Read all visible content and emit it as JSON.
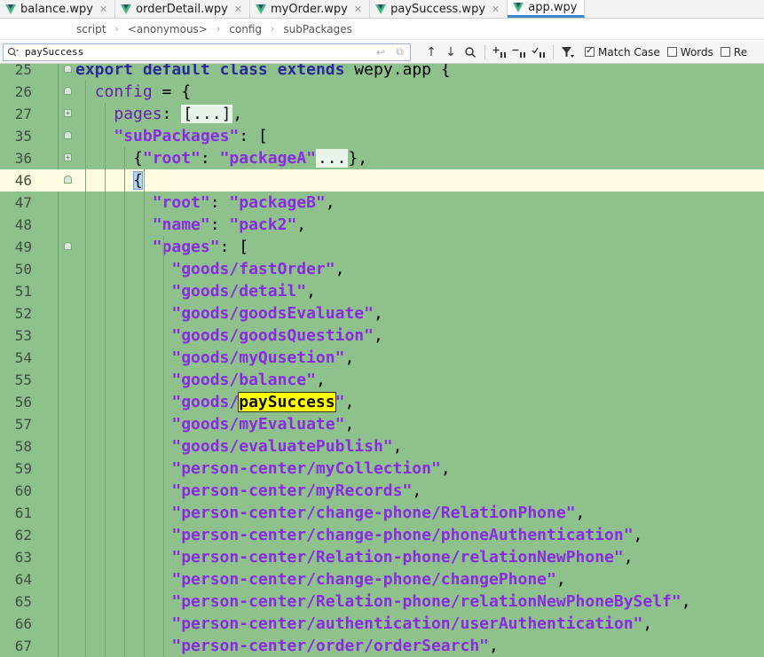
{
  "tabs": [
    {
      "label": "balance.wpy",
      "active": false
    },
    {
      "label": "orderDetail.wpy",
      "active": false
    },
    {
      "label": "myOrder.wpy",
      "active": false
    },
    {
      "label": "paySuccess.wpy",
      "active": false
    },
    {
      "label": "app.wpy",
      "active": true
    }
  ],
  "breadcrumb": [
    "script",
    "<anonymous>",
    "config",
    "subPackages"
  ],
  "search": {
    "query": "paySuccess",
    "match_case_label": "Match Case",
    "match_case_checked": true,
    "words_label": "Words",
    "words_checked": false,
    "regex_label": "Re",
    "regex_checked": false
  },
  "editor": {
    "current_line": "46",
    "lines": [
      {
        "num": "25",
        "text": "export default class extends wepy.app {"
      },
      {
        "num": "26",
        "text": "  config = {"
      },
      {
        "num": "27",
        "text": "    pages: [...],"
      },
      {
        "num": "35",
        "text": "    \"subPackages\": ["
      },
      {
        "num": "36",
        "text": "      {\"root\": \"packageA\"...},"
      },
      {
        "num": "46",
        "text": "      {"
      },
      {
        "num": "47",
        "text": "        \"root\": \"packageB\","
      },
      {
        "num": "48",
        "text": "        \"name\": \"pack2\","
      },
      {
        "num": "49",
        "text": "        \"pages\": ["
      },
      {
        "num": "50",
        "text": "          \"goods/fastOrder\","
      },
      {
        "num": "51",
        "text": "          \"goods/detail\","
      },
      {
        "num": "52",
        "text": "          \"goods/goodsEvaluate\","
      },
      {
        "num": "53",
        "text": "          \"goods/goodsQuestion\","
      },
      {
        "num": "54",
        "text": "          \"goods/myQusetion\","
      },
      {
        "num": "55",
        "text": "          \"goods/balance\","
      },
      {
        "num": "56",
        "text": "          \"goods/paySuccess\","
      },
      {
        "num": "57",
        "text": "          \"goods/myEvaluate\","
      },
      {
        "num": "58",
        "text": "          \"goods/evaluatePublish\","
      },
      {
        "num": "59",
        "text": "          \"person-center/myCollection\","
      },
      {
        "num": "60",
        "text": "          \"person-center/myRecords\","
      },
      {
        "num": "61",
        "text": "          \"person-center/change-phone/RelationPhone\","
      },
      {
        "num": "62",
        "text": "          \"person-center/change-phone/phoneAuthentication\","
      },
      {
        "num": "63",
        "text": "          \"person-center/Relation-phone/relationNewPhone\","
      },
      {
        "num": "64",
        "text": "          \"person-center/change-phone/changePhone\","
      },
      {
        "num": "65",
        "text": "          \"person-center/Relation-phone/relationNewPhoneBySelf\","
      },
      {
        "num": "66",
        "text": "          \"person-center/authentication/userAuthentication\","
      },
      {
        "num": "67",
        "text": "          \"person-center/order/orderSearch\","
      }
    ]
  }
}
